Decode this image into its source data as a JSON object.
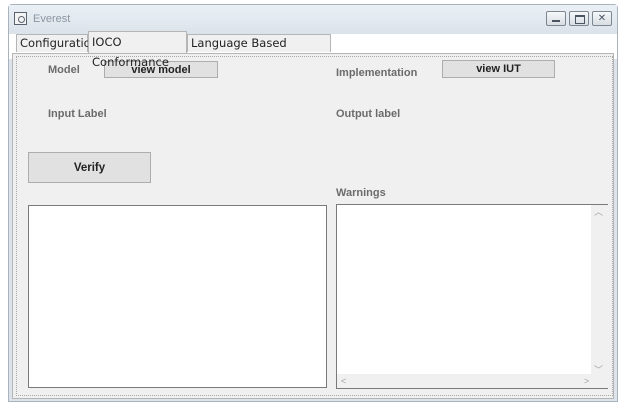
{
  "window": {
    "title": "Everest"
  },
  "tabs": [
    {
      "label": "Configuration"
    },
    {
      "label": "IOCO Conformance"
    },
    {
      "label": "Language Based Conformance"
    }
  ],
  "main": {
    "model_label": "Model",
    "view_model_button": "view model",
    "implementation_label": "Implementation",
    "view_iut_button": "view IUT",
    "input_label": "Input Label",
    "output_label": "Output label",
    "verify_button": "Verify",
    "warnings_label": "Warnings"
  },
  "icons": {
    "app": "app-icon",
    "minimize": "minimize-icon",
    "maximize": "maximize-icon",
    "close": "close-icon",
    "scroll_up": "chevron-up-icon",
    "scroll_down": "chevron-down-icon",
    "scroll_left": "chevron-left-icon",
    "scroll_right": "chevron-right-icon"
  }
}
